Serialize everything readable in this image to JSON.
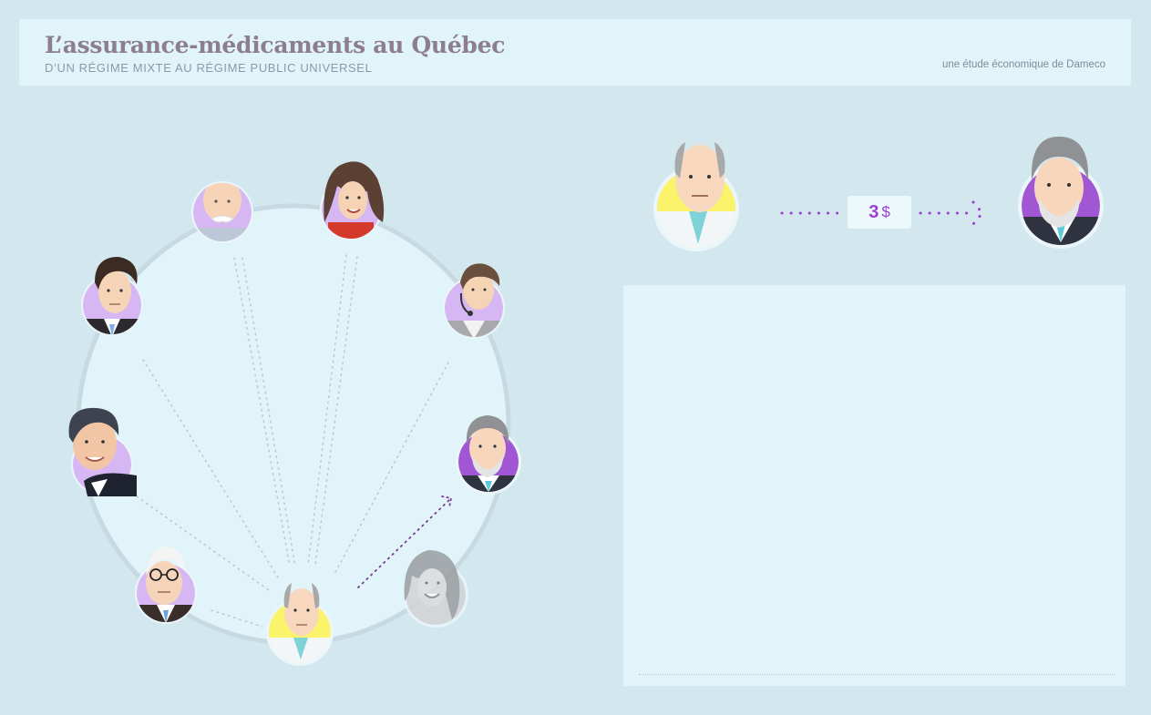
{
  "header": {
    "title": "L’assurance-médicaments au Québec",
    "subtitle": "D’UN RÉGIME MIXTE AU RÉGIME PUBLIC UNIVERSEL",
    "credit": "une étude économique de Dameco"
  },
  "transfer": {
    "amount": "3",
    "currency": "$"
  },
  "colors": {
    "background": "#d2e8ee",
    "panel": "#e0f4fa",
    "accent_purple": "#9b3fd6",
    "lavender": "#d6b7f3",
    "yellow": "#fbf36a"
  },
  "circle_people": [
    {
      "id": "person-grey-mustache",
      "icon": "elderly-man-mustache-portrait"
    },
    {
      "id": "person-brunette-woman",
      "icon": "woman-brown-hair-portrait"
    },
    {
      "id": "person-headset",
      "icon": "man-headset-portrait"
    },
    {
      "id": "person-grey-beard",
      "icon": "man-grey-beard-portrait"
    },
    {
      "id": "person-woman-grey",
      "icon": "woman-greyed-out-portrait"
    },
    {
      "id": "person-bald-center",
      "icon": "bald-man-portrait"
    },
    {
      "id": "person-glasses",
      "icon": "elderly-man-glasses-portrait"
    },
    {
      "id": "person-suit-dark-hair",
      "icon": "man-dark-hair-suit-portrait"
    },
    {
      "id": "person-young-man",
      "icon": "young-man-portrait"
    }
  ]
}
